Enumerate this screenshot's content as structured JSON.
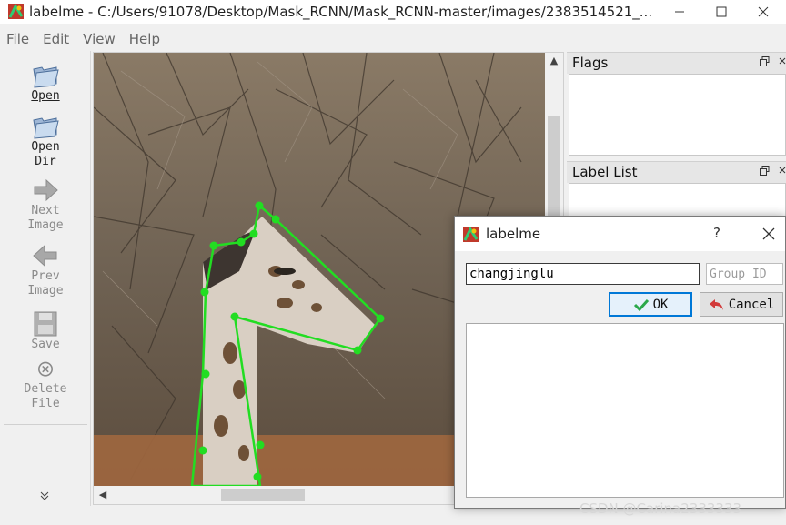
{
  "window": {
    "title": "labelme - C:/Users/91078/Desktop/Mask_RCNN/Mask_RCNN-master/images/2383514521_...",
    "minimize_glyph": "—",
    "maximize_glyph": "☐",
    "close_glyph": "✕"
  },
  "menu": {
    "file": "File",
    "edit": "Edit",
    "view": "View",
    "help": "Help"
  },
  "toolbar": {
    "open": "Open",
    "open_dir_1": "Open",
    "open_dir_2": "Dir",
    "next_1": "Next",
    "next_2": "Image",
    "prev_1": "Prev",
    "prev_2": "Image",
    "save": "Save",
    "delete_1": "Delete",
    "delete_2": "File",
    "more": "»"
  },
  "docks": {
    "flags_title": "Flags",
    "label_list_title": "Label List"
  },
  "dialog": {
    "title": "labelme",
    "help": "?",
    "label_value": "changjinglu",
    "group_id_placeholder": "Group ID",
    "ok_label": "OK",
    "cancel_label": "Cancel"
  },
  "watermark": "CSDN @Carina2333333",
  "colors": {
    "polygon": "#22dd22",
    "ok_border": "#0078d7",
    "cancel_icon": "#d23a3a",
    "ok_icon": "#2aa84a"
  },
  "icons": {
    "open": "folder-open-icon",
    "open_dir": "folder-open-icon",
    "next": "arrow-right-icon",
    "prev": "arrow-left-icon",
    "save": "floppy-disk-icon",
    "delete": "delete-circle-icon"
  }
}
